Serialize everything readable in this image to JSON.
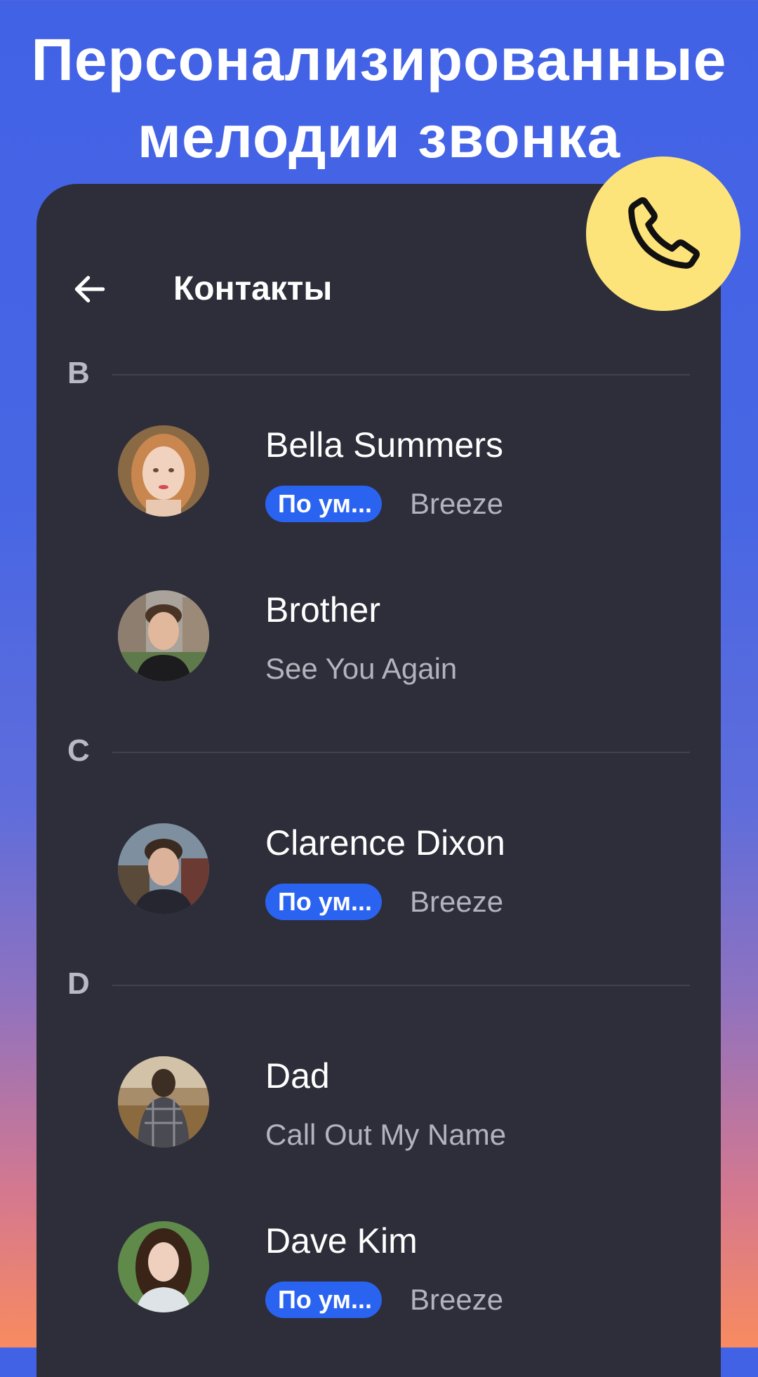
{
  "headline": {
    "line1": "Персонализированные",
    "line2": "мелодии звонка"
  },
  "call_badge": {
    "icon": "phone-icon",
    "color": "#fde47a"
  },
  "appbar": {
    "back_icon": "arrow-left-icon",
    "title": "Контакты"
  },
  "colors": {
    "card_background": "#2e2e3a",
    "pill_accent": "#2b63f1"
  },
  "sections": [
    {
      "letter": "B",
      "contacts": [
        {
          "name": "Bella Summers",
          "badge": "По ум...",
          "ringtone": "Breeze"
        },
        {
          "name": "Brother",
          "badge": "",
          "ringtone": "See You Again"
        }
      ]
    },
    {
      "letter": "C",
      "contacts": [
        {
          "name": "Clarence Dixon",
          "badge": "По ум...",
          "ringtone": "Breeze"
        }
      ]
    },
    {
      "letter": "D",
      "contacts": [
        {
          "name": "Dad",
          "badge": "",
          "ringtone": "Call Out My Name"
        },
        {
          "name": "Dave Kim",
          "badge": "По ум...",
          "ringtone": "Breeze"
        }
      ]
    }
  ]
}
